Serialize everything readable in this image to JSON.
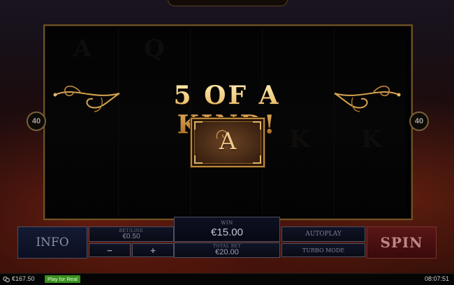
{
  "reels": {
    "left_badge": "40",
    "right_badge": "40",
    "win_message": "5 OF A KIND!",
    "win_symbol": "A"
  },
  "controls": {
    "info_label": "INFO",
    "bet_label": "BET/LINE",
    "bet_value": "€0.50",
    "minus_label": "−",
    "plus_label": "+",
    "win_label": "WIN",
    "win_value": "€15.00",
    "balance_label": "TOTAL BET",
    "balance_value": "€20.00",
    "autoplay_label": "AUTOPLAY",
    "turbo_label": "TURBO MODE",
    "spin_label": "SPIN"
  },
  "statusbar": {
    "balance": "€167.50",
    "play_for_real_label": "Play for Real",
    "clock": "08:07:51"
  },
  "icons": {
    "coins": "coins-icon",
    "flourish": "scroll-flourish-icon"
  },
  "colors": {
    "gold": "#e6b860",
    "spin_red": "#5a1616",
    "play_green": "#3a8f1f",
    "panel_navy": "#101425"
  }
}
